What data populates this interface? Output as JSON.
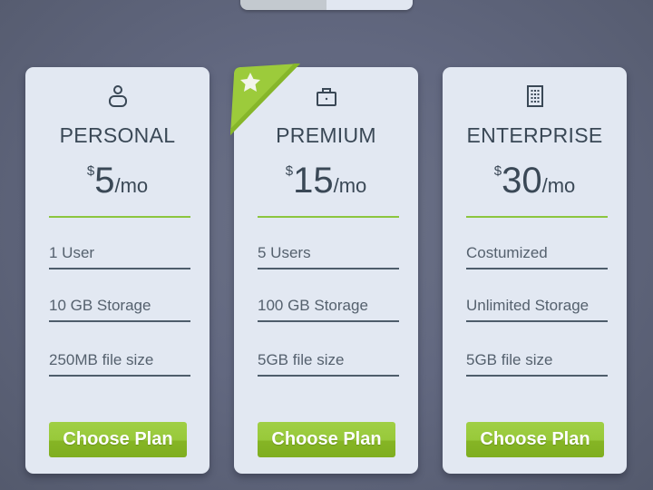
{
  "toggle": {
    "segments": [
      "",
      ""
    ],
    "active_index": 0
  },
  "plans": [
    {
      "name": "PERSONAL",
      "icon": "user-icon",
      "currency": "$",
      "amount": "5",
      "period": "/mo",
      "features": [
        "1 User",
        "10 GB Storage",
        "250MB file size"
      ],
      "button_label": "Choose Plan",
      "featured": false
    },
    {
      "name": "PREMIUM",
      "icon": "briefcase-icon",
      "currency": "$",
      "amount": "15",
      "period": "/mo",
      "features": [
        "5 Users",
        "100 GB Storage",
        "5GB file size"
      ],
      "button_label": "Choose Plan",
      "featured": true,
      "badge_icon": "star-icon"
    },
    {
      "name": "ENTERPRISE",
      "icon": "building-icon",
      "currency": "$",
      "amount": "30",
      "period": "/mo",
      "features": [
        "Costumized",
        "Unlimited Storage",
        "5GB file size"
      ],
      "button_label": "Choose Plan",
      "featured": false
    }
  ],
  "colors": {
    "accent": "#8cc63f",
    "card_bg": "#e2e8f2",
    "text": "#3a4856",
    "background": "#626880"
  }
}
